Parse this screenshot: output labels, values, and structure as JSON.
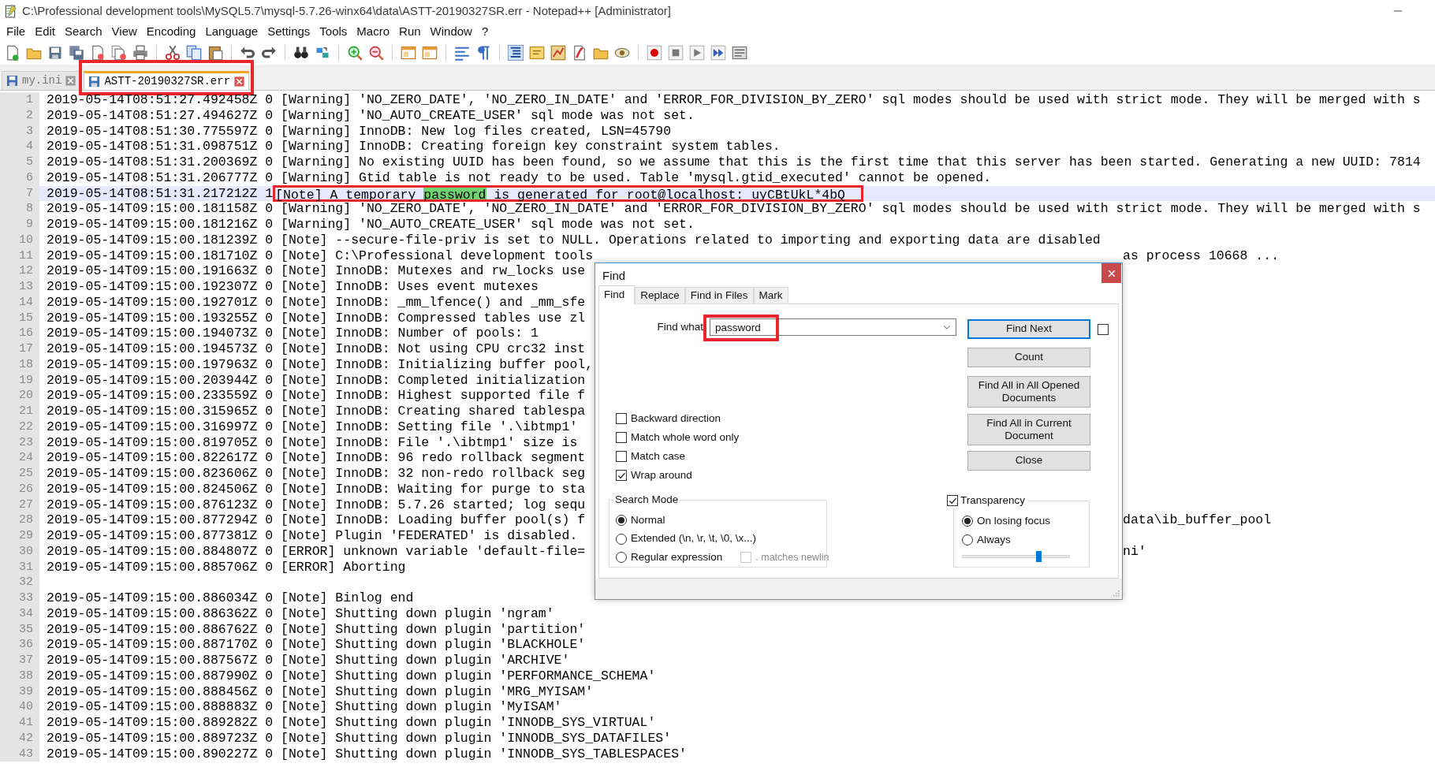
{
  "window": {
    "title": "C:\\Professional development tools\\MySQL5.7\\mysql-5.7.26-winx64\\data\\ASTT-20190327SR.err - Notepad++ [Administrator]"
  },
  "menu": [
    "File",
    "Edit",
    "Search",
    "View",
    "Encoding",
    "Language",
    "Settings",
    "Tools",
    "Macro",
    "Run",
    "Window",
    "?"
  ],
  "tabs": [
    {
      "label": "my.ini",
      "selected": false,
      "annotated": false
    },
    {
      "label": "ASTT-20190327SR.err",
      "selected": true,
      "annotated": true
    }
  ],
  "editor": {
    "lines": [
      {
        "n": "1",
        "current": false,
        "text": "2019-05-14T08:51:27.492458Z 0 [Warning] 'NO_ZERO_DATE', 'NO_ZERO_IN_DATE' and 'ERROR_FOR_DIVISION_BY_ZERO' sql modes should be used with strict mode. They will be merged with s"
      },
      {
        "n": "2",
        "current": false,
        "text": "2019-05-14T08:51:27.494627Z 0 [Warning] 'NO_AUTO_CREATE_USER' sql mode was not set."
      },
      {
        "n": "3",
        "current": false,
        "text": "2019-05-14T08:51:30.775597Z 0 [Warning] InnoDB: New log files created, LSN=45790"
      },
      {
        "n": "4",
        "current": false,
        "text": "2019-05-14T08:51:31.098751Z 0 [Warning] InnoDB: Creating foreign key constraint system tables."
      },
      {
        "n": "5",
        "current": false,
        "text": "2019-05-14T08:51:31.200369Z 0 [Warning] No existing UUID has been found, so we assume that this is the first time that this server has been started. Generating a new UUID: 7814"
      },
      {
        "n": "6",
        "current": false,
        "text": "2019-05-14T08:51:31.206777Z 0 [Warning] Gtid table is not ready to be used. Table 'mysql.gtid_executed' cannot be opened."
      },
      {
        "n": "7",
        "current": true,
        "text": "2019-05-14T08:51:31.217212Z 1 ",
        "annotation": [
          {
            "text": "[Note] A temporary ",
            "match": false
          },
          {
            "text": "password",
            "match": true
          },
          {
            "text": " is generated for root@localhost: uyCBtUkL*4bQ",
            "match": false
          }
        ]
      },
      {
        "n": "8",
        "current": false,
        "text": "2019-05-14T09:15:00.181158Z 0 [Warning] 'NO_ZERO_DATE', 'NO_ZERO_IN_DATE' and 'ERROR_FOR_DIVISION_BY_ZERO' sql modes should be used with strict mode. They will be merged with s"
      },
      {
        "n": "9",
        "current": false,
        "text": "2019-05-14T09:15:00.181216Z 0 [Warning] 'NO_AUTO_CREATE_USER' sql mode was not set."
      },
      {
        "n": "10",
        "current": false,
        "text": "2019-05-14T09:15:00.181239Z 0 [Note] --secure-file-priv is set to NULL. Operations related to importing and exporting data are disabled"
      },
      {
        "n": "11",
        "current": false,
        "text": "2019-05-14T09:15:00.181710Z 0 [Note] C:\\Professional development tools",
        "tail": "as process 10668 ..."
      },
      {
        "n": "12",
        "current": false,
        "text": "2019-05-14T09:15:00.191663Z 0 [Note] InnoDB: Mutexes and rw_locks use"
      },
      {
        "n": "13",
        "current": false,
        "text": "2019-05-14T09:15:00.192307Z 0 [Note] InnoDB: Uses event mutexes"
      },
      {
        "n": "14",
        "current": false,
        "text": "2019-05-14T09:15:00.192701Z 0 [Note] InnoDB: _mm_lfence() and _mm_sfe"
      },
      {
        "n": "15",
        "current": false,
        "text": "2019-05-14T09:15:00.193255Z 0 [Note] InnoDB: Compressed tables use zl"
      },
      {
        "n": "16",
        "current": false,
        "text": "2019-05-14T09:15:00.194073Z 0 [Note] InnoDB: Number of pools: 1"
      },
      {
        "n": "17",
        "current": false,
        "text": "2019-05-14T09:15:00.194573Z 0 [Note] InnoDB: Not using CPU crc32 inst"
      },
      {
        "n": "18",
        "current": false,
        "text": "2019-05-14T09:15:00.197963Z 0 [Note] InnoDB: Initializing buffer pool,"
      },
      {
        "n": "19",
        "current": false,
        "text": "2019-05-14T09:15:00.203944Z 0 [Note] InnoDB: Completed initialization"
      },
      {
        "n": "20",
        "current": false,
        "text": "2019-05-14T09:15:00.233559Z 0 [Note] InnoDB: Highest supported file f"
      },
      {
        "n": "21",
        "current": false,
        "text": "2019-05-14T09:15:00.315965Z 0 [Note] InnoDB: Creating shared tablespa"
      },
      {
        "n": "22",
        "current": false,
        "text": "2019-05-14T09:15:00.316997Z 0 [Note] InnoDB: Setting file '.\\ibtmp1'"
      },
      {
        "n": "23",
        "current": false,
        "text": "2019-05-14T09:15:00.819705Z 0 [Note] InnoDB: File '.\\ibtmp1' size is"
      },
      {
        "n": "24",
        "current": false,
        "text": "2019-05-14T09:15:00.822617Z 0 [Note] InnoDB: 96 redo rollback segment"
      },
      {
        "n": "25",
        "current": false,
        "text": "2019-05-14T09:15:00.823606Z 0 [Note] InnoDB: 32 non-redo rollback seg"
      },
      {
        "n": "26",
        "current": false,
        "text": "2019-05-14T09:15:00.824506Z 0 [Note] InnoDB: Waiting for purge to sta"
      },
      {
        "n": "27",
        "current": false,
        "text": "2019-05-14T09:15:00.876123Z 0 [Note] InnoDB: 5.7.26 started; log sequ"
      },
      {
        "n": "28",
        "current": false,
        "text": "2019-05-14T09:15:00.877294Z 0 [Note] InnoDB: Loading buffer pool(s) f",
        "tail": "data\\ib_buffer_pool"
      },
      {
        "n": "29",
        "current": false,
        "text": "2019-05-14T09:15:00.877381Z 0 [Note] Plugin 'FEDERATED' is disabled."
      },
      {
        "n": "30",
        "current": false,
        "text": "2019-05-14T09:15:00.884807Z 0 [ERROR] unknown variable 'default-file=",
        "tail": "ni'"
      },
      {
        "n": "31",
        "current": false,
        "text": "2019-05-14T09:15:00.885706Z 0 [ERROR] Aborting"
      },
      {
        "n": "32",
        "current": false
      },
      {
        "n": "33",
        "current": false,
        "text": "2019-05-14T09:15:00.886034Z 0 [Note] Binlog end"
      },
      {
        "n": "34",
        "current": false,
        "text": "2019-05-14T09:15:00.886362Z 0 [Note] Shutting down plugin 'ngram'"
      },
      {
        "n": "35",
        "current": false,
        "text": "2019-05-14T09:15:00.886762Z 0 [Note] Shutting down plugin 'partition'"
      },
      {
        "n": "36",
        "current": false,
        "text": "2019-05-14T09:15:00.887170Z 0 [Note] Shutting down plugin 'BLACKHOLE'"
      },
      {
        "n": "37",
        "current": false,
        "text": "2019-05-14T09:15:00.887567Z 0 [Note] Shutting down plugin 'ARCHIVE'"
      },
      {
        "n": "38",
        "current": false,
        "text": "2019-05-14T09:15:00.887990Z 0 [Note] Shutting down plugin 'PERFORMANCE_SCHEMA'"
      },
      {
        "n": "39",
        "current": false,
        "text": "2019-05-14T09:15:00.888456Z 0 [Note] Shutting down plugin 'MRG_MYISAM'"
      },
      {
        "n": "40",
        "current": false,
        "text": "2019-05-14T09:15:00.888883Z 0 [Note] Shutting down plugin 'MyISAM'"
      },
      {
        "n": "41",
        "current": false,
        "text": "2019-05-14T09:15:00.889282Z 0 [Note] Shutting down plugin 'INNODB_SYS_VIRTUAL'"
      },
      {
        "n": "42",
        "current": false,
        "text": "2019-05-14T09:15:00.889723Z 0 [Note] Shutting down plugin 'INNODB_SYS_DATAFILES'"
      },
      {
        "n": "43",
        "current": false,
        "text": "2019-05-14T09:15:00.890227Z 0 [Note] Shutting down plugin 'INNODB_SYS_TABLESPACES'"
      }
    ]
  },
  "find_dialog": {
    "title": "Find",
    "tabs": [
      {
        "label": "Find",
        "selected": true
      },
      {
        "label": "Replace",
        "selected": false
      },
      {
        "label": "Find in Files",
        "selected": false
      },
      {
        "label": "Mark",
        "selected": false
      }
    ],
    "find_what": {
      "label": "Find what",
      "value": "password",
      "annotated": true
    },
    "buttons": [
      {
        "label": "Find Next",
        "default": true
      },
      {
        "label": "Count",
        "default": false
      },
      {
        "label": "Find All in All Opened Documents",
        "default": false
      },
      {
        "label": "Find All in Current Document",
        "default": false
      },
      {
        "label": "Close",
        "default": false
      }
    ],
    "side_checkbox": {
      "checked": false
    },
    "options": [
      {
        "label": "Backward direction",
        "checked": false
      },
      {
        "label": "Match whole word only",
        "checked": false
      },
      {
        "label": "Match case",
        "checked": false
      },
      {
        "label": "Wrap around",
        "checked": true
      }
    ],
    "search_mode": {
      "title": "Search Mode",
      "options": [
        {
          "label": "Normal",
          "selected": true
        },
        {
          "label": "Extended (\\n, \\r, \\t, \\0, \\x...)",
          "selected": false
        },
        {
          "label": "Regular expression",
          "selected": false
        }
      ],
      "dot_newline": {
        "label": ". matches newlin",
        "checked": false,
        "disabled": true
      }
    },
    "transparency": {
      "label": "Transparency",
      "checked": true,
      "options": [
        {
          "label": "On losing focus",
          "selected": true
        },
        {
          "label": "Always",
          "selected": false
        }
      ],
      "level": 0.71
    }
  }
}
